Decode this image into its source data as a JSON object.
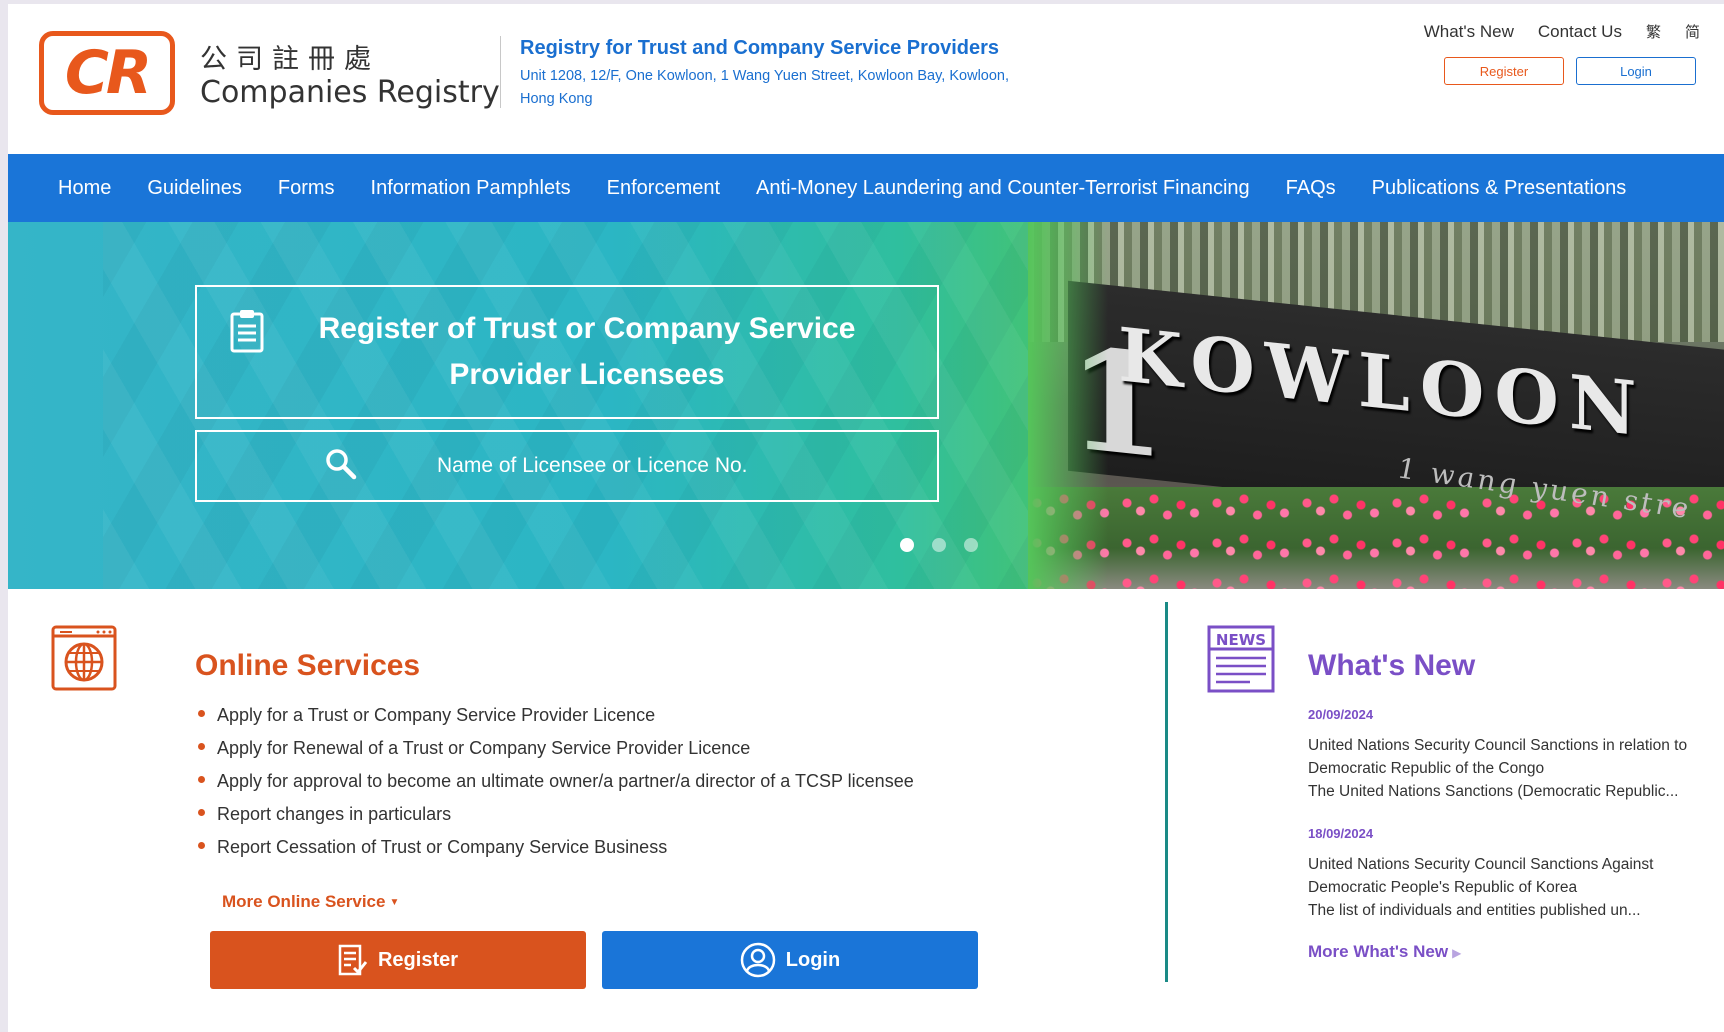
{
  "header": {
    "logo_text": "CR",
    "logo_zh": "公司註冊處",
    "logo_en": "Companies Registry",
    "registry_title": "Registry for Trust and Company Service Providers",
    "registry_address": "Unit 1208, 12/F, One Kowloon, 1 Wang Yuen Street, Kowloon Bay, Kowloon, Hong Kong",
    "top_links": [
      "What's New",
      "Contact Us"
    ],
    "lang_traditional": "繁",
    "lang_simplified": "简",
    "register_label": "Register",
    "login_label": "Login"
  },
  "nav": {
    "items": [
      "Home",
      "Guidelines",
      "Forms",
      "Information Pamphlets",
      "Enforcement",
      "Anti-Money Laundering and Counter-Terrorist Financing",
      "FAQs",
      "Publications & Presentations"
    ]
  },
  "hero": {
    "title": "Register of Trust or Company Service Provider Licensees",
    "search_placeholder": "Name of Licensee or Licence No.",
    "slides_total": 3,
    "slide_active": 1,
    "photo_sign": "KOWLOON",
    "photo_sign_number": "1",
    "photo_sign_sub": "1 wang yuen stre"
  },
  "online_services": {
    "title": "Online Services",
    "items": [
      "Apply for a Trust or Company Service Provider Licence",
      "Apply for Renewal of a Trust or Company Service Provider Licence",
      "Apply for approval to become an ultimate owner/a partner/a director of a TCSP licensee",
      "Report changes in particulars",
      "Report Cessation of Trust or Company Service Business"
    ],
    "more_label": "More Online Service",
    "register_label": "Register",
    "login_label": "Login"
  },
  "whats_new": {
    "title": "What's New",
    "icon_label": "NEWS",
    "news": [
      {
        "date": "20/09/2024",
        "headline": "United Nations Security Council Sanctions in relation to Democratic Republic of the Congo",
        "summary": "The United Nations Sanctions (Democratic Republic..."
      },
      {
        "date": "18/09/2024",
        "headline": "United Nations Security Council Sanctions Against Democratic People's Republic of Korea",
        "summary": "The list of individuals and entities published un..."
      }
    ],
    "more_label": "More What's New"
  },
  "colors": {
    "brand_orange": "#e8581c",
    "nav_blue": "#1a75d8",
    "link_blue": "#1a6fd0",
    "services_orange": "#d9531e",
    "whats_new_purple": "#7a4fc6",
    "divider_teal": "#1a8a86"
  }
}
